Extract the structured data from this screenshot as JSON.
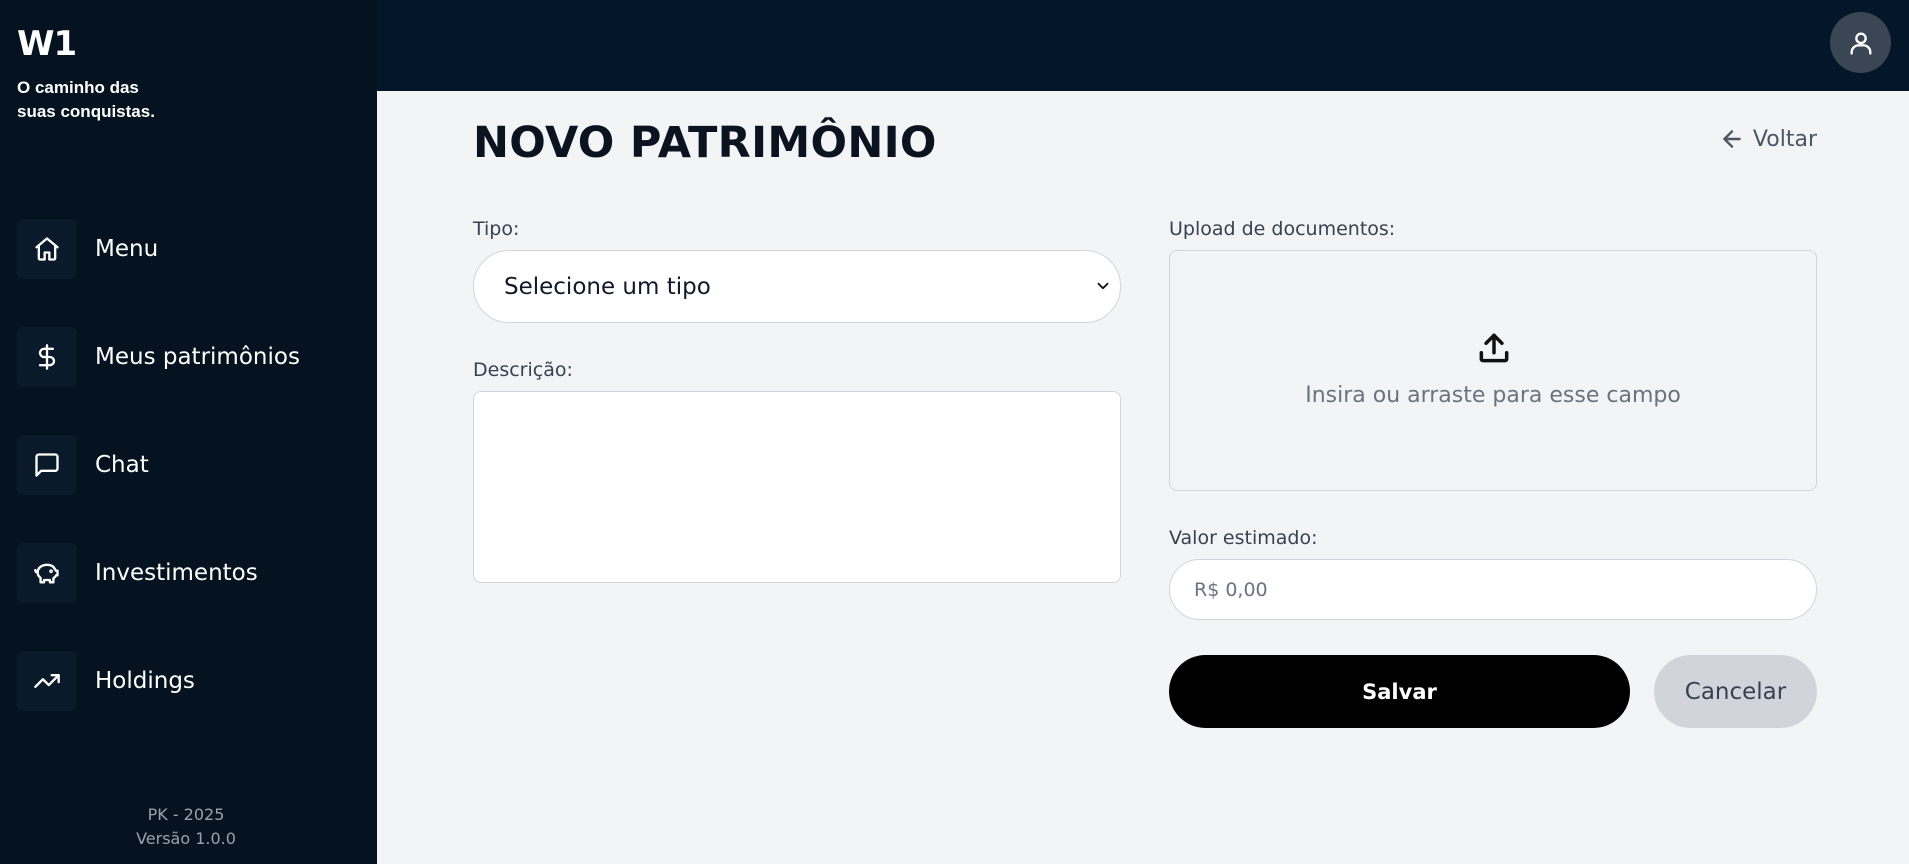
{
  "brand": {
    "logo": "W1",
    "tagline_line1": "O caminho das",
    "tagline_line2": "suas conquistas."
  },
  "sidebar": {
    "items": [
      {
        "label": "Menu",
        "icon": "home-icon"
      },
      {
        "label": "Meus patrimônios",
        "icon": "dollar-icon"
      },
      {
        "label": "Chat",
        "icon": "message-square-icon"
      },
      {
        "label": "Investimentos",
        "icon": "piggy-bank-icon"
      },
      {
        "label": "Holdings",
        "icon": "trending-up-icon"
      }
    ],
    "footer_line1": "PK - 2025",
    "footer_line2": "Versão 1.0.0"
  },
  "header": {
    "avatar_icon": "user-icon"
  },
  "page": {
    "title": "NOVO PATRIMÔNIO",
    "back_label": "Voltar"
  },
  "form": {
    "tipo_label": "Tipo:",
    "tipo_value": "Selecione um tipo",
    "descricao_label": "Descrição:",
    "descricao_value": "",
    "upload_label": "Upload de documentos:",
    "upload_text": "Insira ou arraste para esse campo",
    "valor_label": "Valor estimado:",
    "valor_placeholder": "R$ 0,00",
    "save_label": "Salvar",
    "cancel_label": "Cancelar"
  },
  "colors": {
    "sidebar_bg": "#04131f",
    "topbar_bg": "#04172a",
    "page_bg": "#f3f4f6",
    "primary_button": "#000000",
    "secondary_button": "#d1d5db"
  }
}
